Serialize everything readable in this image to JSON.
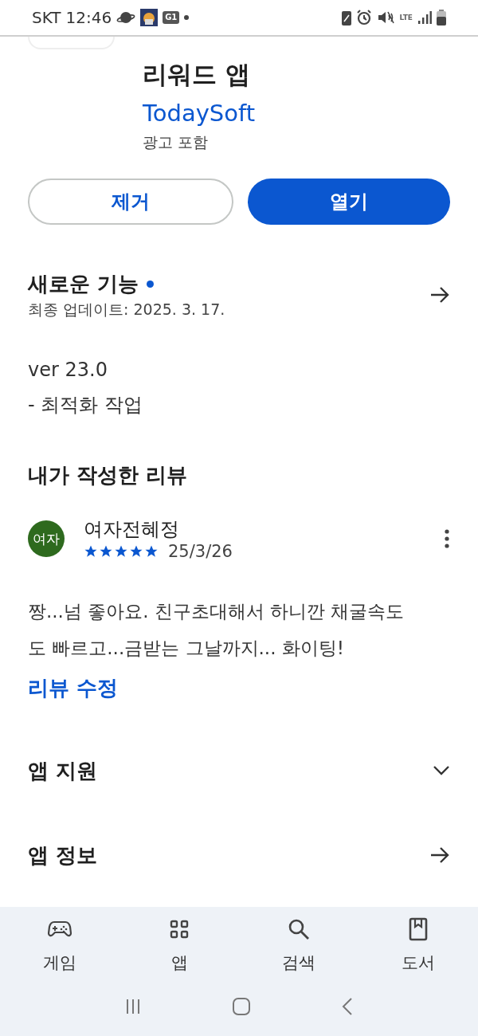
{
  "status_bar": {
    "carrier": "SKT",
    "time": "12:46",
    "badge": "G1",
    "network": "LTE"
  },
  "app": {
    "title": "리워드 앱",
    "developer": "TodaySoft",
    "note": "광고 포함"
  },
  "buttons": [
    {
      "label": "제거",
      "kind": "outlined"
    },
    {
      "label": "열기",
      "kind": "filled"
    }
  ],
  "whats_new": {
    "title": "새로운 기능",
    "new": true,
    "updated": "최종 업데이트: 2025. 3. 17.",
    "lines": [
      "ver 23.0",
      "- 최적화 작업"
    ]
  },
  "my_review": {
    "title": "내가 작성한 리뷰",
    "avatar": "여자",
    "author": "여자전혜정",
    "stars": 5,
    "date": "25/3/26",
    "text": "짱...넘 좋아요. 친구초대해서 하니깐 채굴속도도 빠르고...금받는 그날까지... 화이팅!",
    "edit": "리뷰 수정"
  },
  "sections": [
    {
      "title": "앱 지원",
      "kind": "expand"
    },
    {
      "title": "앱 정보",
      "kind": "link"
    }
  ],
  "bottom_nav": [
    {
      "label": "게임"
    },
    {
      "label": "앱"
    },
    {
      "label": "검색"
    },
    {
      "label": "도서"
    }
  ]
}
